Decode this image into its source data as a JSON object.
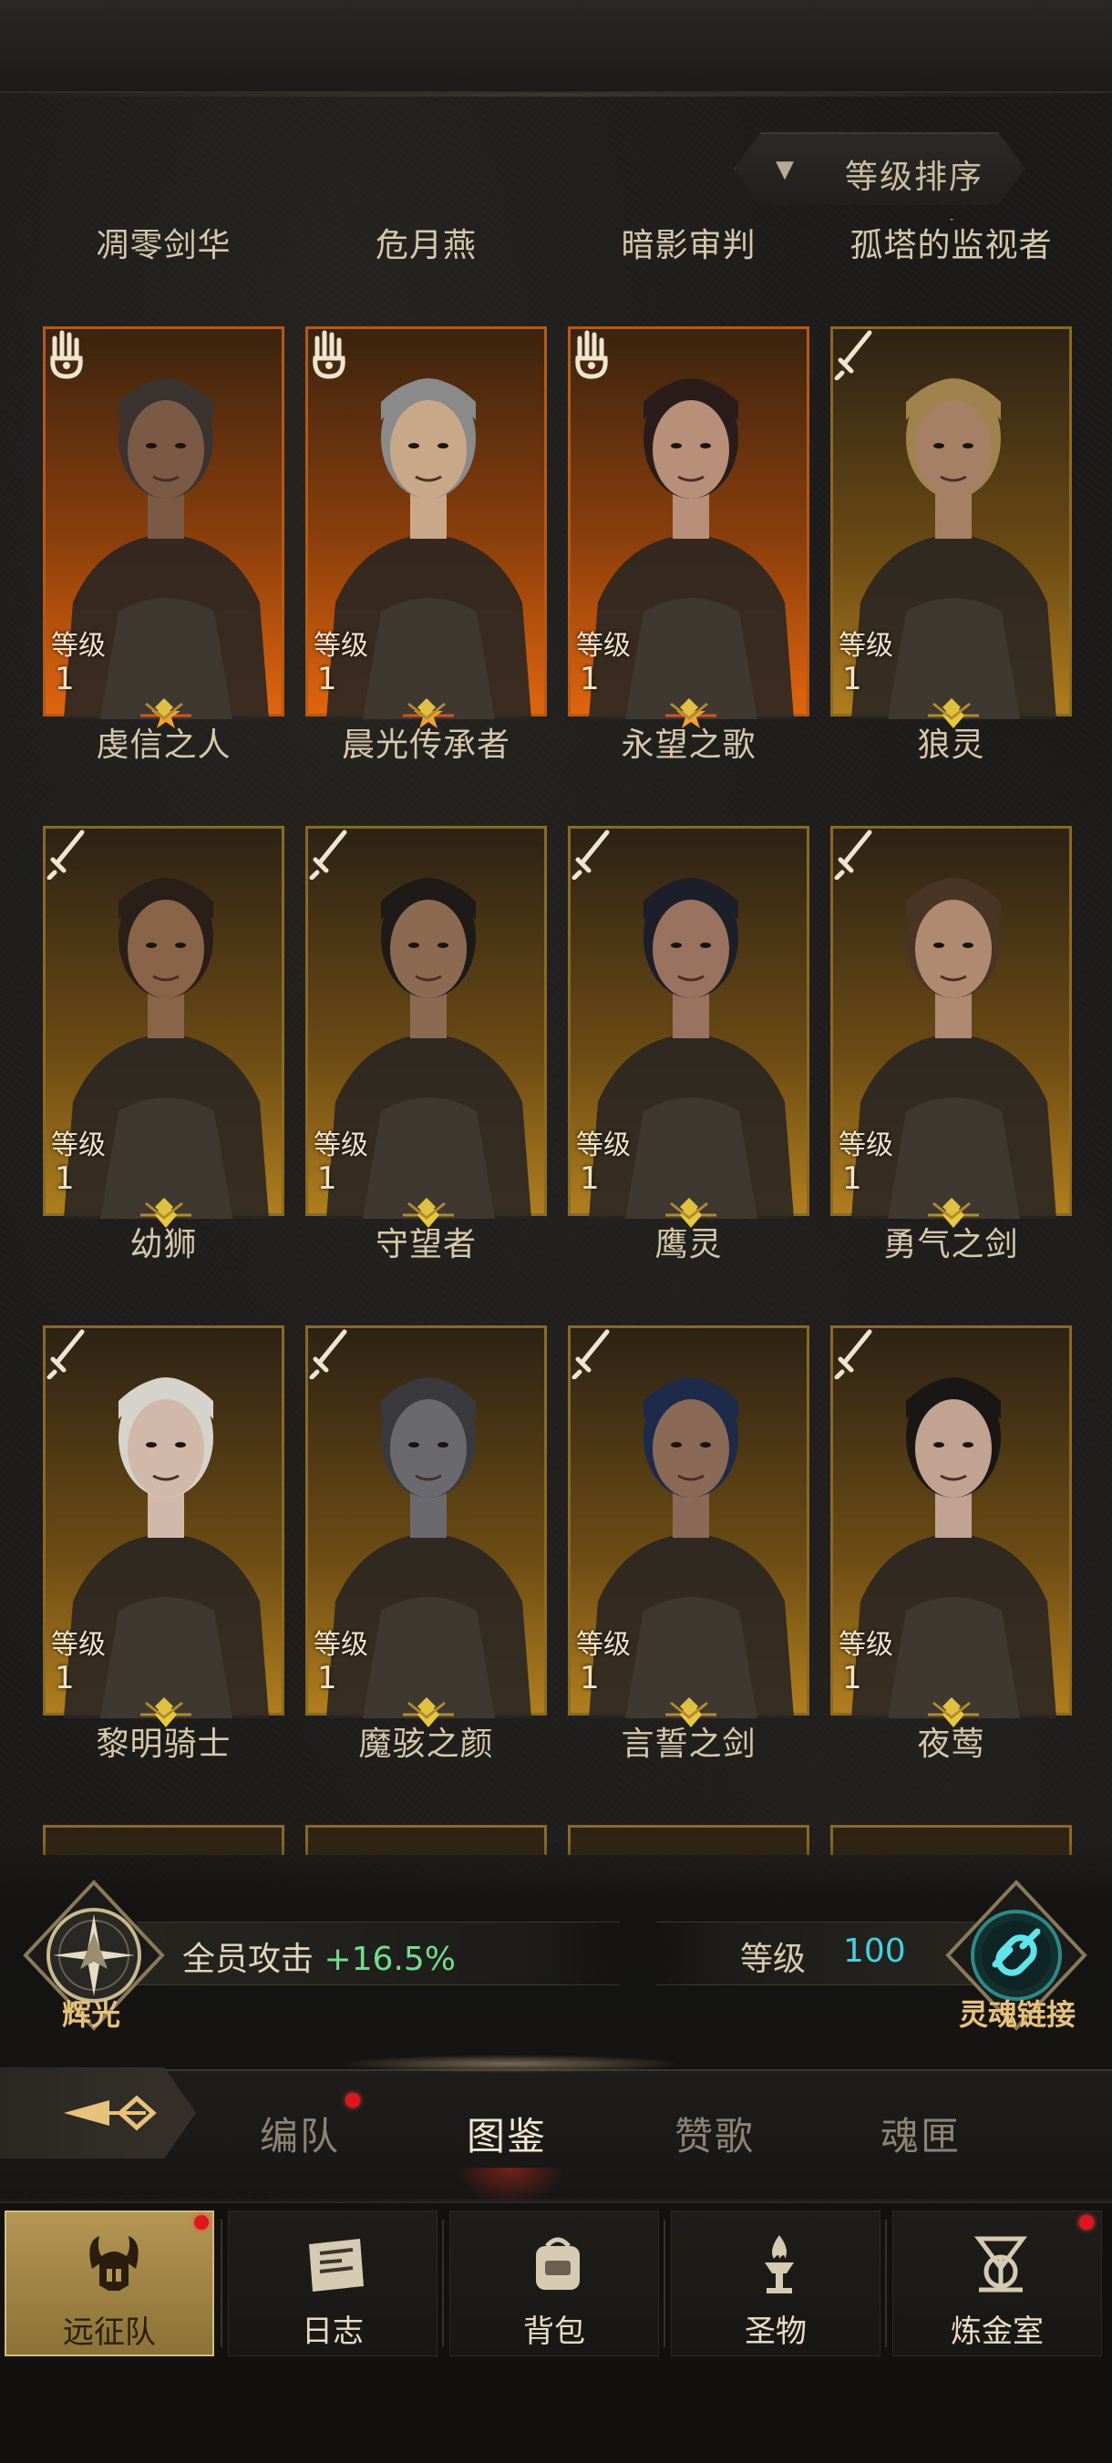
{
  "sort": {
    "label": "等级排序",
    "arrow": "▼"
  },
  "grid": {
    "level_label": "等级",
    "heroes": [
      {
        "name": "凋零剑华",
        "level": "1",
        "role": "hand",
        "frame": "orange",
        "skin": "#7a5a44",
        "hair": "#3a3330"
      },
      {
        "name": "危月燕",
        "level": "1",
        "role": "hand",
        "frame": "orange",
        "skin": "#c9a88a",
        "hair": "#8a8a8a"
      },
      {
        "name": "暗影审判",
        "level": "1",
        "role": "hand",
        "frame": "orange",
        "skin": "#b8907a",
        "hair": "#2a1c1a"
      },
      {
        "name": "孤塔的监视者",
        "level": "1",
        "role": "sword",
        "frame": "gold",
        "skin": "#a68064",
        "hair": "#a0824c"
      },
      {
        "name": "虔信之人",
        "level": "1",
        "role": "sword",
        "frame": "gold",
        "skin": "#8a6448",
        "hair": "#2a1e18"
      },
      {
        "name": "晨光传承者",
        "level": "1",
        "role": "sword",
        "frame": "gold",
        "skin": "#8c6a52",
        "hair": "#1e1a18"
      },
      {
        "name": "永望之歌",
        "level": "1",
        "role": "sword",
        "frame": "gold",
        "skin": "#9a7260",
        "hair": "#1c1e2a"
      },
      {
        "name": "狼灵",
        "level": "1",
        "role": "sword",
        "frame": "gold",
        "skin": "#b08a70",
        "hair": "#4a3424"
      },
      {
        "name": "幼狮",
        "level": "1",
        "role": "sword",
        "frame": "gold",
        "skin": "#d2b8a8",
        "hair": "#d6d2cc"
      },
      {
        "name": "守望者",
        "level": "1",
        "role": "sword",
        "frame": "gold",
        "skin": "#6a6a6e",
        "hair": "#3a3a3e"
      },
      {
        "name": "鹰灵",
        "level": "1",
        "role": "sword",
        "frame": "gold",
        "skin": "#8a6a56",
        "hair": "#1e2a4a"
      },
      {
        "name": "勇气之剑",
        "level": "1",
        "role": "sword",
        "frame": "gold",
        "skin": "#c2a290",
        "hair": "#1a1616"
      },
      {
        "name": "黎明骑士",
        "level": "",
        "role": "",
        "frame": "partial",
        "skin": "#7a3a3a",
        "hair": "#7a2a2a"
      },
      {
        "name": "魔骇之颜",
        "level": "",
        "role": "",
        "frame": "partial",
        "skin": "#3a5a4a",
        "hair": "#2a3a2a"
      },
      {
        "name": "言誓之剑",
        "level": "",
        "role": "",
        "frame": "partial",
        "skin": "#3a3836",
        "hair": "#3a3836"
      },
      {
        "name": "夜莺",
        "level": "",
        "role": "",
        "frame": "partial",
        "skin": "#b8b4ac",
        "hair": "#c8c4bc"
      }
    ]
  },
  "status": {
    "radiance_label": "辉光",
    "attack_label": "全员攻击",
    "attack_value": "+16.5%",
    "level_label": "等级",
    "level_value": "100",
    "soul_link_label": "灵魂链接"
  },
  "tabs": [
    {
      "label": "编队",
      "active": false,
      "badge": true
    },
    {
      "label": "图鉴",
      "active": true,
      "badge": false
    },
    {
      "label": "赞歌",
      "active": false,
      "badge": false
    },
    {
      "label": "魂匣",
      "active": false,
      "badge": false
    }
  ],
  "nav": [
    {
      "label": "远征队",
      "icon": "horned-helmet-icon",
      "active": true,
      "badge": true
    },
    {
      "label": "日志",
      "icon": "journal-icon",
      "active": false,
      "badge": false
    },
    {
      "label": "背包",
      "icon": "backpack-icon",
      "active": false,
      "badge": false
    },
    {
      "label": "圣物",
      "icon": "relic-torch-icon",
      "active": false,
      "badge": false
    },
    {
      "label": "炼金室",
      "icon": "alchemy-icon",
      "active": false,
      "badge": true
    }
  ],
  "colors": {
    "accent_gold": "#d8bb76",
    "attack_green": "#6fe08a",
    "level_cyan": "#3fd3e0",
    "badge_red": "#e0161e"
  }
}
